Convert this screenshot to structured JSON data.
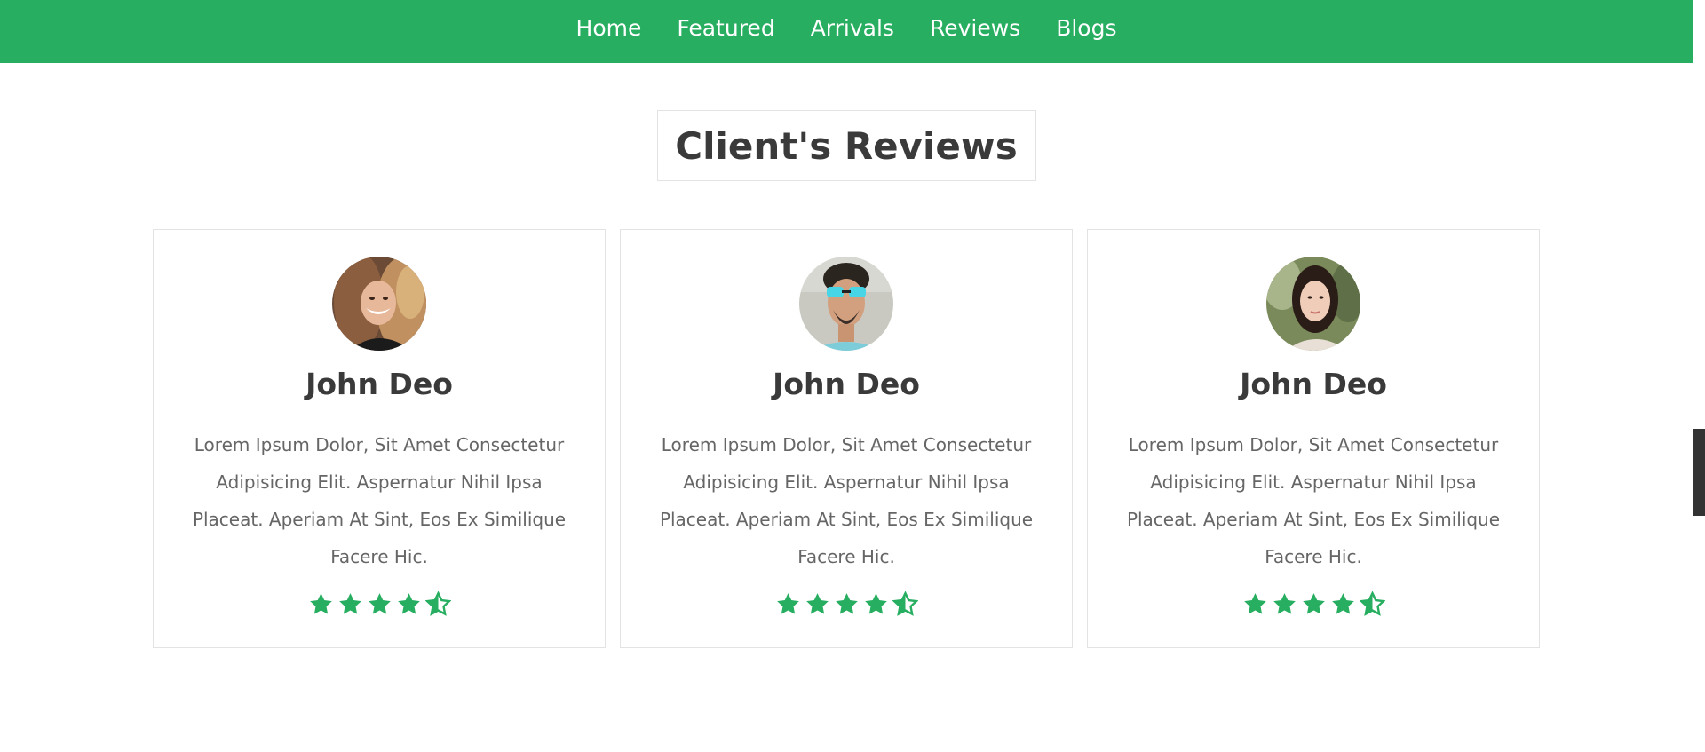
{
  "nav": {
    "links": [
      "Home",
      "Featured",
      "Arrivals",
      "Reviews",
      "Blogs"
    ]
  },
  "section": {
    "title": "Client's Reviews"
  },
  "reviews": [
    {
      "name": "John Deo",
      "text": "Lorem Ipsum Dolor, Sit Amet Consectetur Adipisicing Elit. Aspernatur Nihil Ipsa Placeat. Aperiam At Sint, Eos Ex Similique Facere Hic.",
      "rating": 4.5,
      "avatar": "woman-curly-hair-photo"
    },
    {
      "name": "John Deo",
      "text": "Lorem Ipsum Dolor, Sit Amet Consectetur Adipisicing Elit. Aspernatur Nihil Ipsa Placeat. Aperiam At Sint, Eos Ex Similique Facere Hic.",
      "rating": 4.5,
      "avatar": "man-sunglasses-photo"
    },
    {
      "name": "John Deo",
      "text": "Lorem Ipsum Dolor, Sit Amet Consectetur Adipisicing Elit. Aspernatur Nihil Ipsa Placeat. Aperiam At Sint, Eos Ex Similique Facere Hic.",
      "rating": 4.5,
      "avatar": "woman-dark-hair-photo"
    }
  ],
  "colors": {
    "accent": "#27ae60",
    "heading": "#3a3a3a",
    "body_text": "#666666",
    "border": "#e3e3e3"
  }
}
